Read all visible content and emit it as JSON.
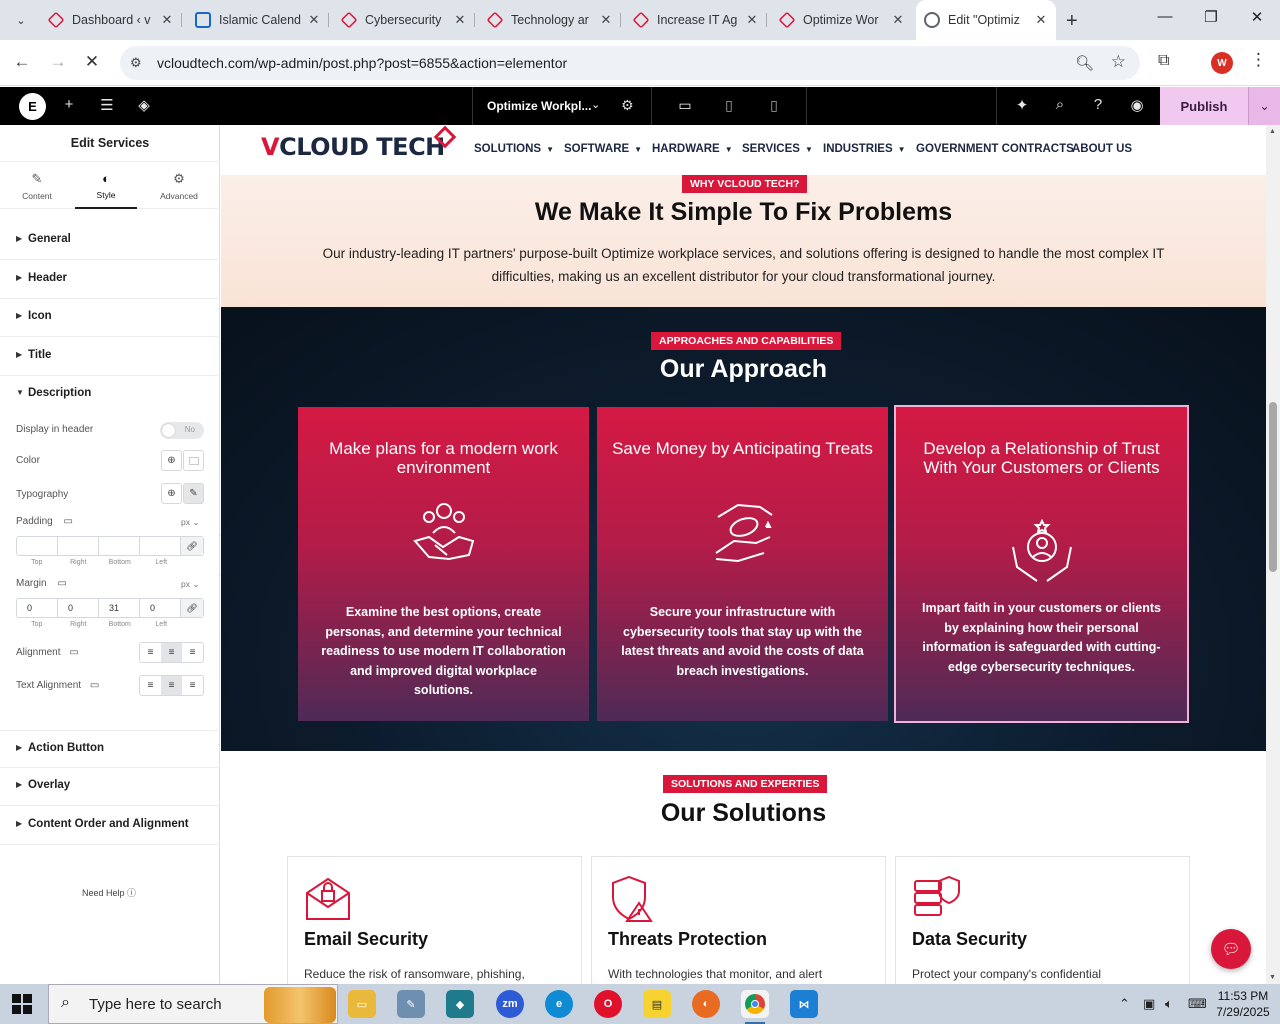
{
  "browser": {
    "tabs": [
      {
        "title": "Dashboard ‹ v",
        "icon": "vcloud-favicon-icon",
        "color": "#d9173b"
      },
      {
        "title": "Islamic Calend",
        "icon": "calendar-favicon-icon",
        "color": "#1a66c9"
      },
      {
        "title": "Cybersecurity",
        "icon": "vcloud-favicon-icon",
        "color": "#d9173b"
      },
      {
        "title": "Technology ar",
        "icon": "vcloud-favicon-icon",
        "color": "#d9173b"
      },
      {
        "title": "Increase IT Ag",
        "icon": "vcloud-favicon-icon",
        "color": "#d9173b"
      },
      {
        "title": "Optimize Wor",
        "icon": "vcloud-favicon-icon",
        "color": "#d9173b"
      },
      {
        "title": "Edit \"Optimiz",
        "icon": "loading-icon",
        "color": "#5f6368",
        "active": true
      }
    ],
    "url": "vcloudtech.com/wp-admin/post.php?post=6855&action=elementor",
    "profile_initial": "W"
  },
  "editor": {
    "document_name": "Optimize Workpl...",
    "publish_label": "Publish"
  },
  "panel": {
    "title": "Edit Services",
    "tabs": [
      "Content",
      "Style",
      "Advanced"
    ],
    "sections_top": [
      "General",
      "Header",
      "Icon",
      "Title"
    ],
    "open_section": "Description",
    "display_in_header_label": "Display in header",
    "toggle_text": "No",
    "color_label": "Color",
    "typography_label": "Typography",
    "padding_label": "Padding",
    "padding_unit": "px",
    "padding_values": [
      "",
      "",
      "",
      ""
    ],
    "dim_labels": [
      "Top",
      "Right",
      "Bottom",
      "Left"
    ],
    "margin_label": "Margin",
    "margin_unit": "px",
    "margin_values": [
      "0",
      "0",
      "31",
      "0"
    ],
    "alignment_label": "Alignment",
    "text_alignment_label": "Text Alignment",
    "sections_bottom": [
      "Action Button",
      "Overlay",
      "Content Order and Alignment"
    ],
    "need_help": "Need Help"
  },
  "site": {
    "brand_v": "V",
    "brand_rest": "CLOUD TECH",
    "menu": [
      {
        "label": "SOLUTIONS",
        "dropdown": true
      },
      {
        "label": "SOFTWARE",
        "dropdown": true
      },
      {
        "label": "HARDWARE",
        "dropdown": true
      },
      {
        "label": "SERVICES",
        "dropdown": true
      },
      {
        "label": "INDUSTRIES",
        "dropdown": true
      },
      {
        "label": "GOVERNMENT CONTRACTS",
        "dropdown": false
      },
      {
        "label": "ABOUT US",
        "dropdown": false
      }
    ],
    "why": {
      "badge": "WHY VCLOUD TECH?",
      "heading": "We Make It Simple To Fix Problems",
      "description": "Our industry-leading IT partners' purpose-built Optimize workplace services, and solutions offering is designed to handle the most complex IT difficulties, making us an excellent distributor for your cloud transformational journey."
    },
    "approach": {
      "badge": "APPROACHES AND CAPABILITIES",
      "heading": "Our Approach",
      "cards": [
        {
          "title": "Make plans for a modern work environment",
          "icon": "team-handshake-icon",
          "description": "Examine the best options, create personas, and determine your technical readiness to use modern IT collaboration and improved digital workplace solutions."
        },
        {
          "title": "Save Money by Anticipating Treats",
          "icon": "coin-hands-icon",
          "description": "Secure your infrastructure with cybersecurity tools that stay up with the latest threats and avoid the costs of data breach investigations."
        },
        {
          "title": "Develop a Relationship of Trust With Your Customers or Clients",
          "icon": "customer-trust-icon",
          "description": "Impart faith in your customers or clients by explaining how their personal information is safeguarded with cutting-edge cybersecurity techniques."
        }
      ]
    },
    "solutions": {
      "badge": "SOLUTIONS AND EXPERTIES",
      "heading": "Our Solutions",
      "cards": [
        {
          "title": "Email Security",
          "icon": "email-lock-icon",
          "description": "Reduce the risk of ransomware, phishing,"
        },
        {
          "title": "Threats Protection",
          "icon": "shield-warning-icon",
          "description": "With technologies that monitor, and alert"
        },
        {
          "title": "Data Security",
          "icon": "database-shield-icon",
          "description": "Protect your company's confidential"
        }
      ]
    }
  },
  "taskbar": {
    "search_placeholder": "Type here to search",
    "time": "11:53 PM",
    "date": "7/29/2025"
  },
  "colors": {
    "brand_red": "#d9173b",
    "navy": "#1c2742",
    "publish_bg": "#f0c8f0"
  }
}
